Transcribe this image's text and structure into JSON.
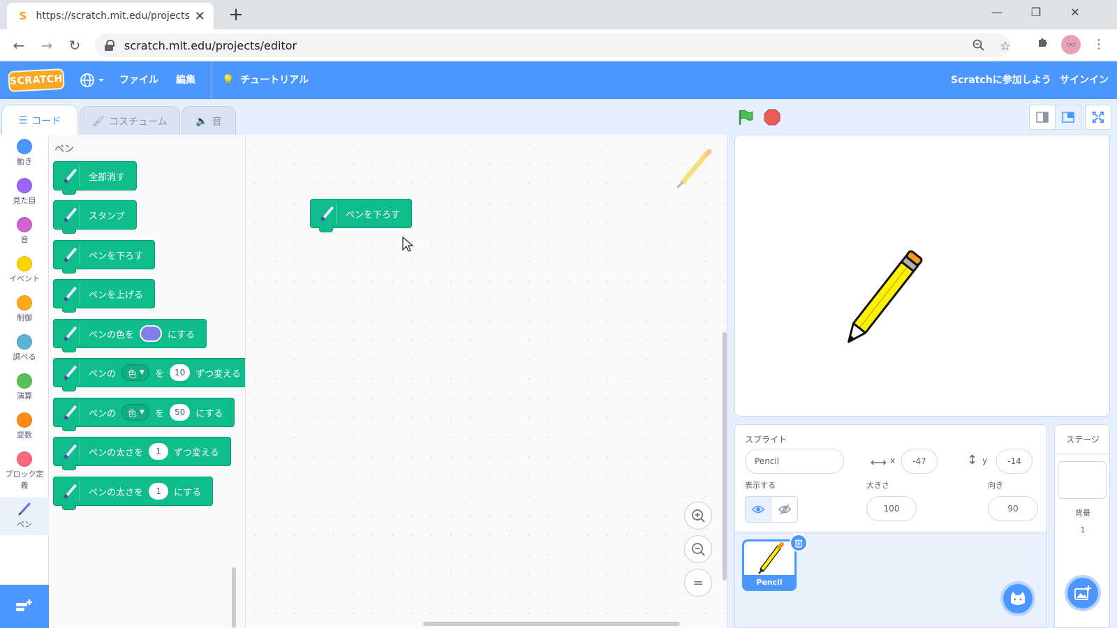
{
  "browser": {
    "tab_title": "https://scratch.mit.edu/projects/e",
    "tab_favicon": "S",
    "new_tab": "+",
    "url": "scratch.mit.edu/projects/editor"
  },
  "menubar": {
    "logo": "SCRATCH",
    "file": "ファイル",
    "edit": "編集",
    "tutorials": "チュートリアル",
    "join": "Scratchに参加しよう",
    "signin": "サインイン"
  },
  "tabs": {
    "code": "コード",
    "costumes": "コスチューム",
    "sounds": "音"
  },
  "categories": [
    {
      "label": "動き",
      "color": "#4c97ff"
    },
    {
      "label": "見た目",
      "color": "#9966ff"
    },
    {
      "label": "音",
      "color": "#cf63cf"
    },
    {
      "label": "イベント",
      "color": "#ffd500"
    },
    {
      "label": "制御",
      "color": "#ffab19"
    },
    {
      "label": "調べる",
      "color": "#5cb1d6"
    },
    {
      "label": "演算",
      "color": "#59c059"
    },
    {
      "label": "変数",
      "color": "#ff8c1a"
    },
    {
      "label": "ブロック定義",
      "color": "#ff6680"
    },
    {
      "label": "ペン",
      "color": "pen"
    }
  ],
  "palette": {
    "title": "ペン",
    "blocks": {
      "clear": "全部消す",
      "stamp": "スタンプ",
      "pen_down": "ペンを下ろす",
      "pen_up": "ペンを上げる",
      "set_color_pre": "ペンの色を",
      "set_color_post": "にする",
      "change_param_pre": "ペンの",
      "param": "色",
      "wo": "を",
      "change_param_value": "10",
      "change_param_post": "ずつ変える",
      "set_param_value": "50",
      "set_param_post": "にする",
      "change_size_pre": "ペンの太さを",
      "change_size_value": "1",
      "change_size_post": "ずつ変える",
      "set_size_pre": "ペンの太さを",
      "set_size_value": "1",
      "set_size_post": "にする"
    },
    "pen_color": "#7f7fe8"
  },
  "code_area": {
    "script_block": "ペンを下ろす",
    "zoom_reset": "="
  },
  "sprite_info": {
    "sprite_label": "スプライト",
    "sprite_name": "Pencil",
    "x_label": "x",
    "x": "-47",
    "y_label": "y",
    "y": "-14",
    "show_label": "表示する",
    "size_label": "大きさ",
    "size": "100",
    "direction_label": "向き",
    "direction": "90"
  },
  "sprite_list": {
    "items": [
      {
        "name": "Pencil"
      }
    ]
  },
  "stage_pane": {
    "title": "ステージ",
    "backdrops_label": "背景",
    "backdrops_count": "1"
  }
}
